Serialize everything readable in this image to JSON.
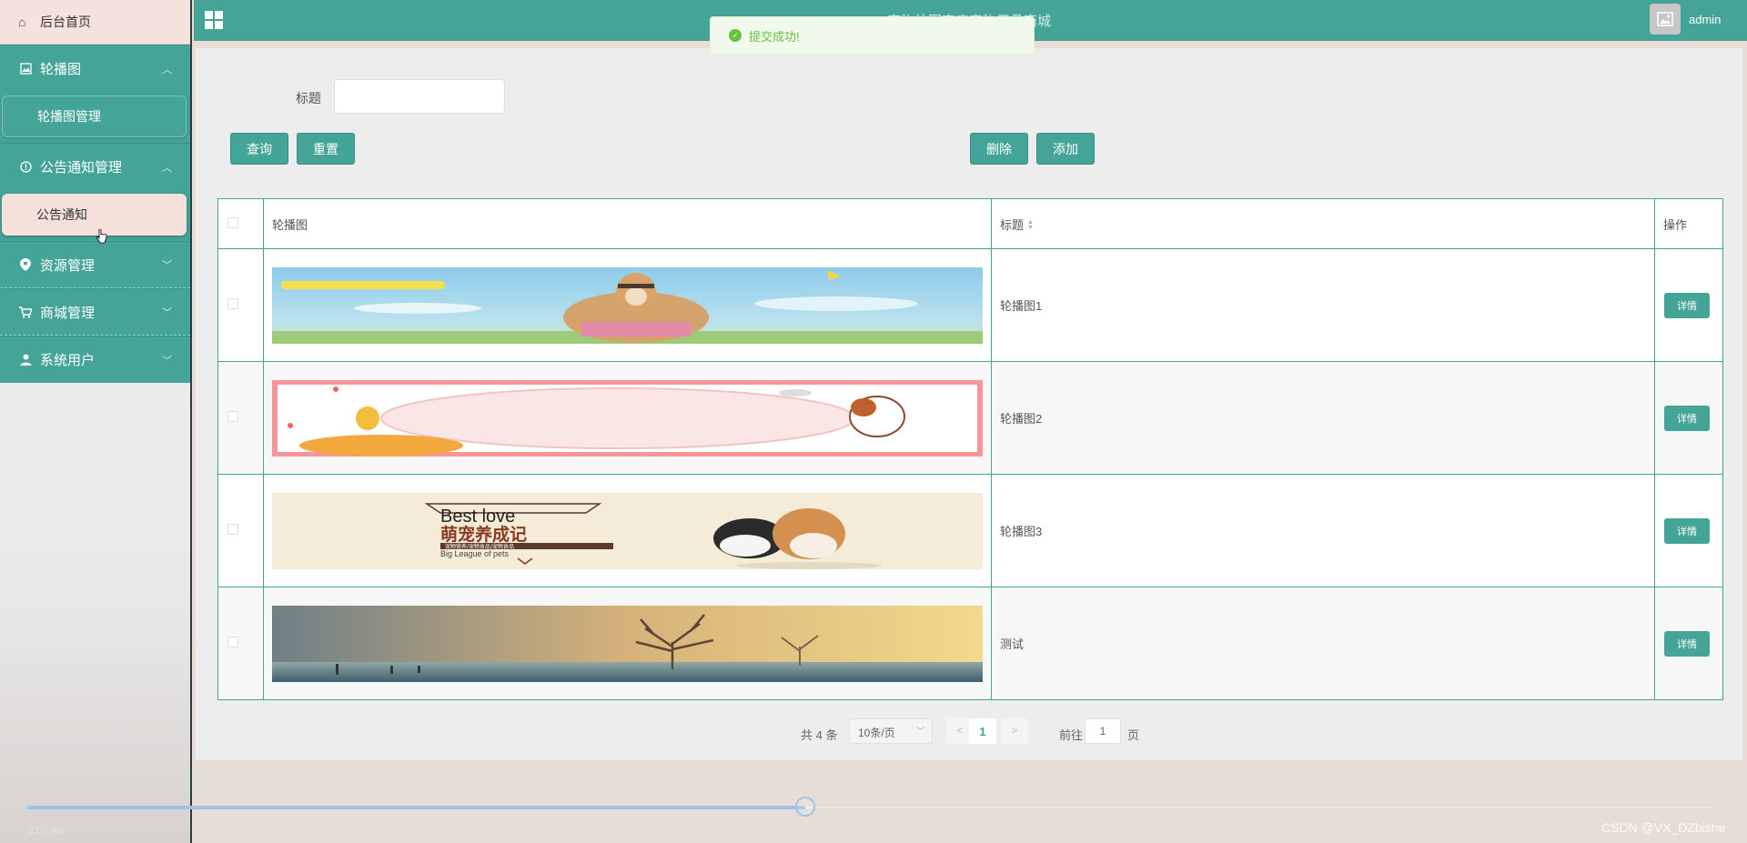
{
  "sidebar": {
    "home": "后台首页",
    "groups": [
      {
        "label": "轮播图",
        "expanded": true,
        "icon": "image-icon",
        "items": [
          "轮播图管理"
        ]
      },
      {
        "label": "公告通知管理",
        "expanded": true,
        "icon": "info-circle-icon",
        "items": [
          "公告通知"
        ]
      },
      {
        "label": "资源管理",
        "expanded": false,
        "icon": "location-pin-icon"
      },
      {
        "label": "商城管理",
        "expanded": false,
        "icon": "cart-icon"
      },
      {
        "label": "系统用户",
        "expanded": false,
        "icon": "user-icon"
      }
    ]
  },
  "topbar": {
    "title": "宠物外围商店宠物用品商城",
    "user": "admin"
  },
  "toast": {
    "message": "提交成功!"
  },
  "search": {
    "label": "标题",
    "value": ""
  },
  "buttons": {
    "query": "查询",
    "reset": "重置",
    "delete": "删除",
    "add": "添加"
  },
  "table": {
    "headers": {
      "image": "轮播图",
      "title": "标题",
      "actions": "操作"
    },
    "rows": [
      {
        "title": "轮播图1",
        "action": "详情"
      },
      {
        "title": "轮播图2",
        "action": "详情"
      },
      {
        "title": "轮播图3",
        "action": "详情"
      },
      {
        "title": "测试",
        "action": "详情"
      }
    ]
  },
  "banner3": {
    "line1": "Best love",
    "line2": "萌宠养成记",
    "line3": "宠物营养/宠物食品/宠物食品",
    "line4": "Big League of pets"
  },
  "pagination": {
    "total": "共 4 条",
    "page_size": "10条/页",
    "current": "1",
    "goto_label": "前往",
    "goto_value": "1",
    "page_unit": "页"
  },
  "video": {
    "time": "0:02:48",
    "progress": 0.45
  },
  "watermark": "CSDN @VX_DZbishe",
  "colors": {
    "accent": "#43a497",
    "toast_bg": "#f0f9eb",
    "toast_text": "#67c23a"
  }
}
